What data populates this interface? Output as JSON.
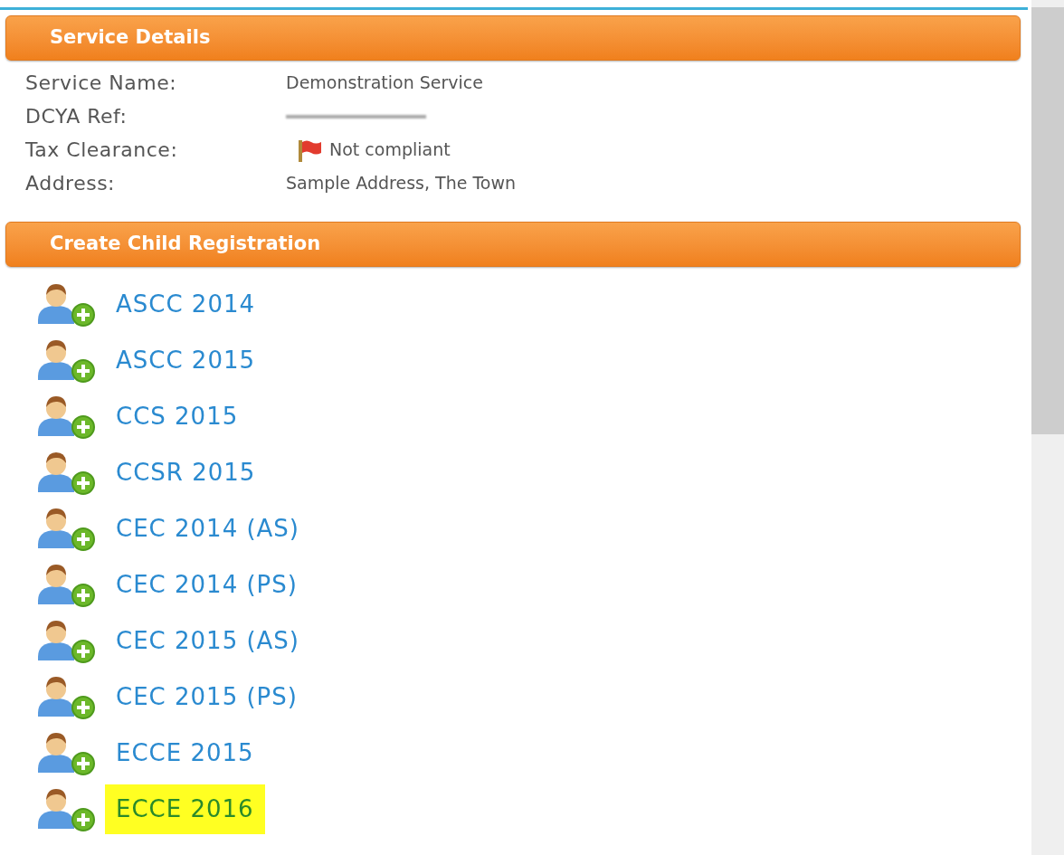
{
  "service_details": {
    "title": "Service Details",
    "fields": [
      {
        "label": "Service Name:",
        "value": "Demonstration Service",
        "kind": "text"
      },
      {
        "label": "DCYA Ref:",
        "kind": "blurred"
      },
      {
        "label": "Tax Clearance:",
        "value": "Not compliant",
        "kind": "flag"
      },
      {
        "label": "Address:",
        "value": "Sample Address, The Town",
        "kind": "text"
      }
    ]
  },
  "create_child_registration": {
    "title": "Create Child Registration",
    "items": [
      {
        "label": "ASCC 2014",
        "highlighted": false
      },
      {
        "label": "ASCC 2015",
        "highlighted": false
      },
      {
        "label": "CCS 2015",
        "highlighted": false
      },
      {
        "label": "CCSR 2015",
        "highlighted": false
      },
      {
        "label": "CEC 2014 (AS)",
        "highlighted": false
      },
      {
        "label": "CEC 2014 (PS)",
        "highlighted": false
      },
      {
        "label": "CEC 2015 (AS)",
        "highlighted": false
      },
      {
        "label": "CEC 2015 (PS)",
        "highlighted": false
      },
      {
        "label": "ECCE 2015",
        "highlighted": false
      },
      {
        "label": "ECCE 2016",
        "highlighted": true
      }
    ]
  }
}
